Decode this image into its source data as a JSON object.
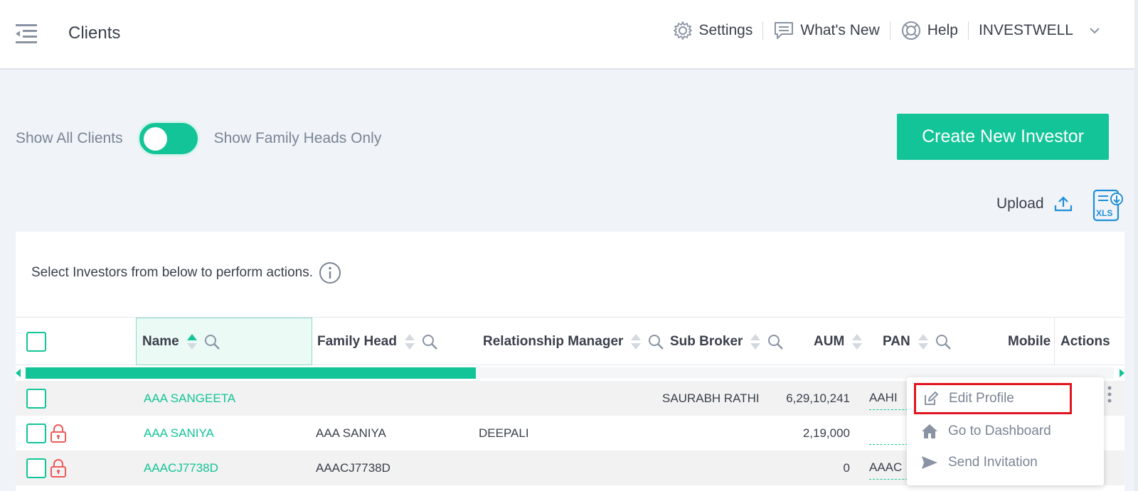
{
  "header": {
    "title": "Clients",
    "settings_label": "Settings",
    "whatsnew_label": "What's New",
    "help_label": "Help",
    "account_label": "INVESTWELL"
  },
  "toolbar": {
    "toggle_left_label": "Show All Clients",
    "toggle_right_label": "Show Family Heads Only",
    "toggle_on": true,
    "create_button": "Create New Investor",
    "upload_label": "Upload",
    "xls_label": "XLS"
  },
  "panel": {
    "hint": "Select Investors from below to perform actions."
  },
  "table": {
    "columns": {
      "name": "Name",
      "family_head": "Family Head",
      "rm": "Relationship Manager",
      "sub_broker": "Sub Broker",
      "aum": "AUM",
      "pan": "PAN",
      "mobile": "Mobile",
      "actions": "Actions"
    },
    "rows": [
      {
        "name": "AAA SANGEETA",
        "family_head": "",
        "rm": "",
        "sub_broker": "SAURABH RATHI",
        "aum": "6,29,10,241",
        "pan": "AAHI"
      },
      {
        "name": "AAA SANIYA",
        "family_head": "AAA SANIYA",
        "rm": "DEEPALI",
        "sub_broker": "",
        "aum": "2,19,000",
        "pan": ""
      },
      {
        "name": "AAACJ7738D",
        "family_head": "AAACJ7738D",
        "rm": "",
        "sub_broker": "",
        "aum": "0",
        "pan": "AAAC"
      }
    ]
  },
  "actions_menu": {
    "items": [
      "Edit Profile",
      "Go to Dashboard",
      "Send Invitation"
    ]
  },
  "colors": {
    "accent": "#12c497",
    "highlight": "#e0141e",
    "lock": "#ef5a5a"
  }
}
